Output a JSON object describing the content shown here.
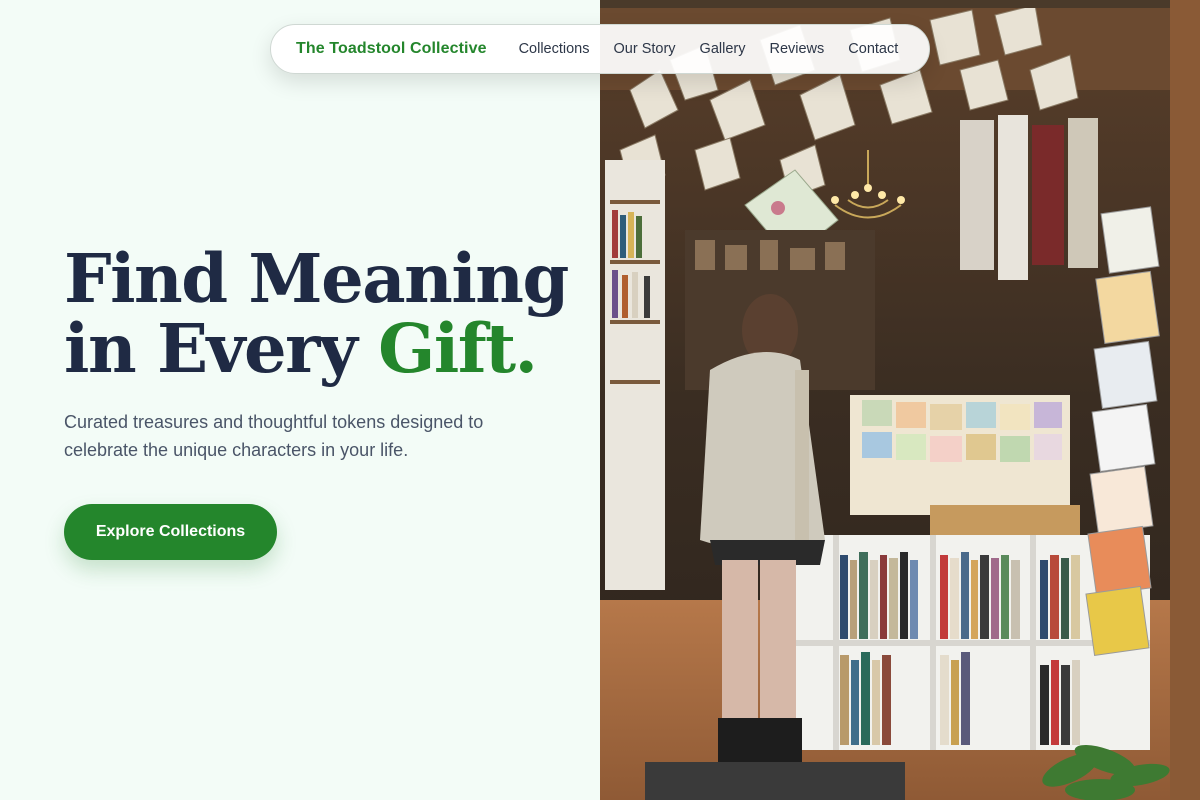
{
  "brand": {
    "name": "The Toadstool Collective"
  },
  "nav": {
    "links": [
      {
        "label": "Collections"
      },
      {
        "label": "Our Story"
      },
      {
        "label": "Gallery"
      },
      {
        "label": "Reviews"
      },
      {
        "label": "Contact"
      }
    ]
  },
  "hero": {
    "title_line1": "Find Meaning",
    "title_line2_prefix": "in Every ",
    "title_accent": "Gift.",
    "subtitle": "Curated treasures and thoughtful tokens designed to celebrate the unique characters in your life.",
    "cta_label": "Explore Collections"
  },
  "colors": {
    "accent": "#24862c",
    "heading": "#1f2a44",
    "body_text": "#4a5568",
    "background": "#f3fcf7"
  },
  "icons": []
}
